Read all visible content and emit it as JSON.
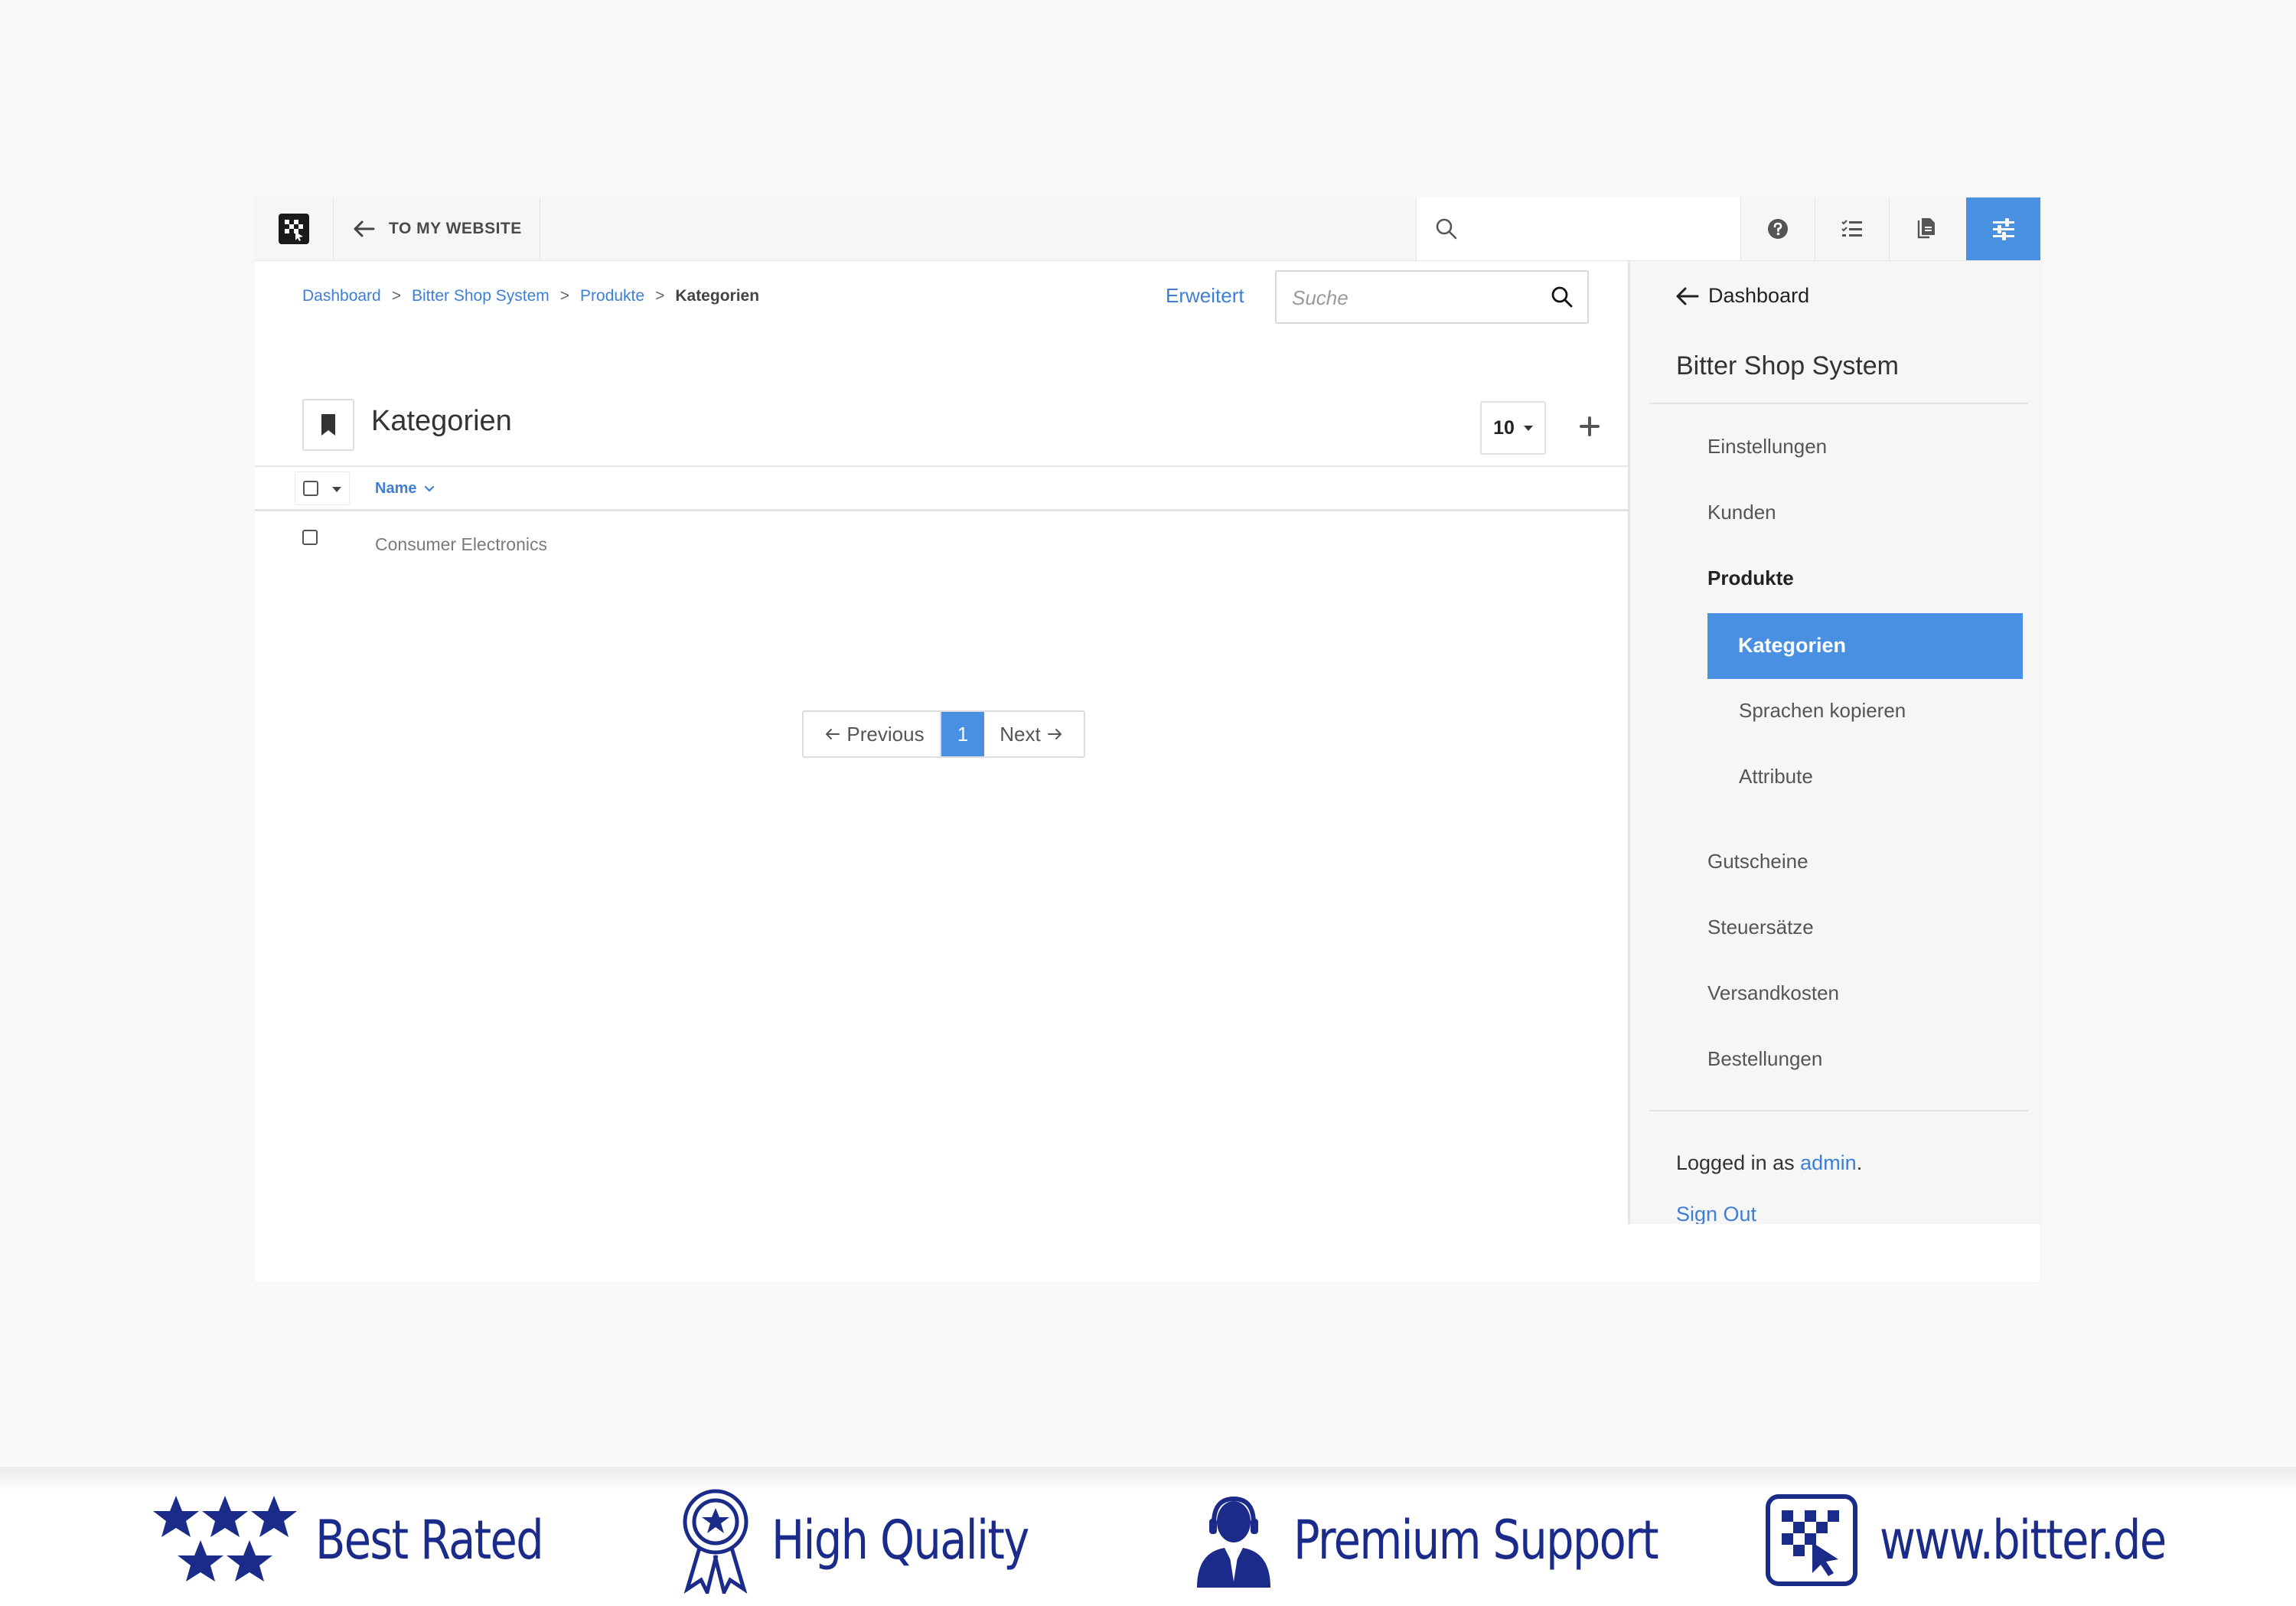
{
  "toolbar": {
    "back_label": "TO MY WEBSITE",
    "search_placeholder": "",
    "accent": "#4a90e2"
  },
  "breadcrumb": [
    {
      "label": "Dashboard"
    },
    {
      "label": "Bitter Shop System"
    },
    {
      "label": "Produkte"
    },
    {
      "label": "Kategorien"
    }
  ],
  "breadcrumb_separator": ">",
  "main": {
    "advanced_label": "Erweitert",
    "search_placeholder": "Suche",
    "title": "Kategorien",
    "per_page": "10",
    "column_name": "Name",
    "rows": [
      {
        "name": "Consumer Electronics"
      }
    ],
    "pager": {
      "previous": "Previous",
      "page": "1",
      "next": "Next"
    }
  },
  "sidebar": {
    "back_label": "Dashboard",
    "title": "Bitter Shop System",
    "items": [
      {
        "label": "Einstellungen"
      },
      {
        "label": "Kunden"
      },
      {
        "label": "Produkte"
      },
      {
        "label": "Kategorien"
      },
      {
        "label": "Sprachen kopieren"
      },
      {
        "label": "Attribute"
      },
      {
        "label": "Gutscheine"
      },
      {
        "label": "Steuersätze"
      },
      {
        "label": "Versandkosten"
      },
      {
        "label": "Bestellungen"
      }
    ],
    "logged_in_prefix": "Logged in as",
    "user": "admin",
    "logged_in_suffix": ".",
    "sign_out": "Sign Out"
  },
  "footer": {
    "features": [
      {
        "label": "Best Rated",
        "icon": "stars-icon"
      },
      {
        "label": "High Quality",
        "icon": "award-ribbon-icon"
      },
      {
        "label": "Premium Support",
        "icon": "support-agent-icon"
      },
      {
        "label": "www.bitter.de",
        "icon": "bitter-logo-icon"
      }
    ],
    "color": "#1a2b8a"
  }
}
